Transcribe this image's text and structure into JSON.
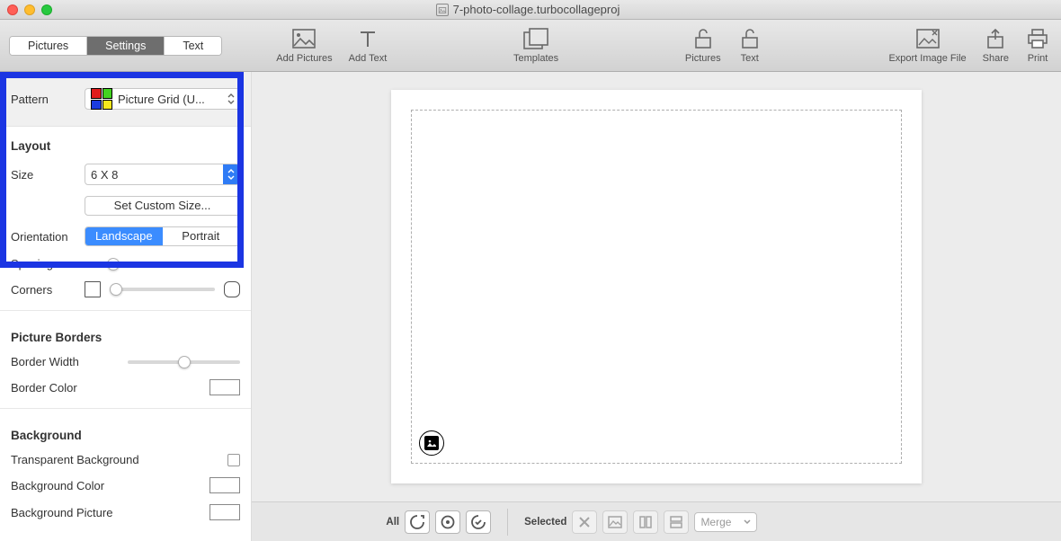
{
  "titlebar": {
    "filename": "7-photo-collage.turbocollageproj"
  },
  "tabs": {
    "pictures": "Pictures",
    "settings": "Settings",
    "text": "Text",
    "active": "settings"
  },
  "toolbar": {
    "addPictures": "Add Pictures",
    "addText": "Add Text",
    "templates": "Templates",
    "lockPictures": "Pictures",
    "lockText": "Text",
    "exportImage": "Export Image File",
    "share": "Share",
    "print": "Print"
  },
  "sidebar": {
    "pattern": {
      "label": "Pattern",
      "value": "Picture Grid (U..."
    },
    "layout": {
      "title": "Layout",
      "sizeLabel": "Size",
      "sizeValue": "6 X 8",
      "setCustom": "Set Custom Size...",
      "orientationLabel": "Orientation",
      "landscape": "Landscape",
      "portrait": "Portrait",
      "spacingLabel": "Spacing",
      "cornersLabel": "Corners"
    },
    "pictureBorders": {
      "title": "Picture Borders",
      "widthLabel": "Border Width",
      "colorLabel": "Border Color"
    },
    "background": {
      "title": "Background",
      "transparentLabel": "Transparent Background",
      "colorLabel": "Background Color",
      "pictureLabel": "Background Picture"
    }
  },
  "bottombar": {
    "all": "All",
    "selected": "Selected",
    "merge": "Merge"
  }
}
